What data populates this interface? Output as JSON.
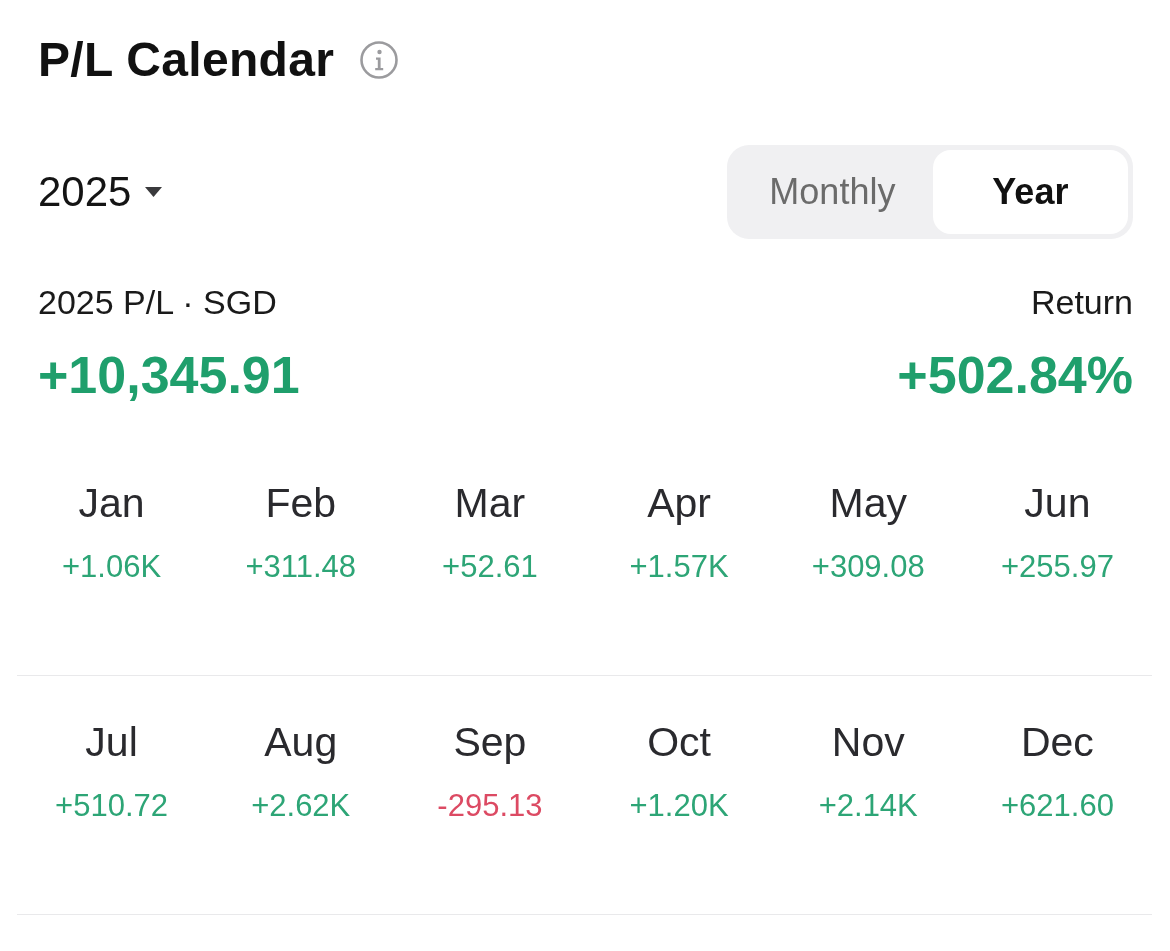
{
  "header": {
    "title": "P/L Calendar"
  },
  "period": {
    "year": "2025"
  },
  "view_toggle": [
    {
      "label": "Monthly",
      "selected": false
    },
    {
      "label": "Year",
      "selected": true
    }
  ],
  "summary": {
    "label": "2025 P/L · SGD",
    "value": "+10,345.91",
    "return_label": "Return",
    "return_value": "+502.84%"
  },
  "months": [
    {
      "name": "Jan",
      "value": "+1.06K",
      "color": "#2da576"
    },
    {
      "name": "Feb",
      "value": "+311.48",
      "color": "#2da576"
    },
    {
      "name": "Mar",
      "value": "+52.61",
      "color": "#2da576"
    },
    {
      "name": "Apr",
      "value": "+1.57K",
      "color": "#2da576"
    },
    {
      "name": "May",
      "value": "+309.08",
      "color": "#2da576"
    },
    {
      "name": "Jun",
      "value": "+255.97",
      "color": "#2da576"
    },
    {
      "name": "Jul",
      "value": "+510.72",
      "color": "#2da576"
    },
    {
      "name": "Aug",
      "value": "+2.62K",
      "color": "#2da576"
    },
    {
      "name": "Sep",
      "value": "-295.13",
      "color": "#dc4a63"
    },
    {
      "name": "Oct",
      "value": "+1.20K",
      "color": "#2da576"
    },
    {
      "name": "Nov",
      "value": "+2.14K",
      "color": "#2da576"
    },
    {
      "name": "Dec",
      "value": "+621.60",
      "color": "#2da576"
    }
  ]
}
